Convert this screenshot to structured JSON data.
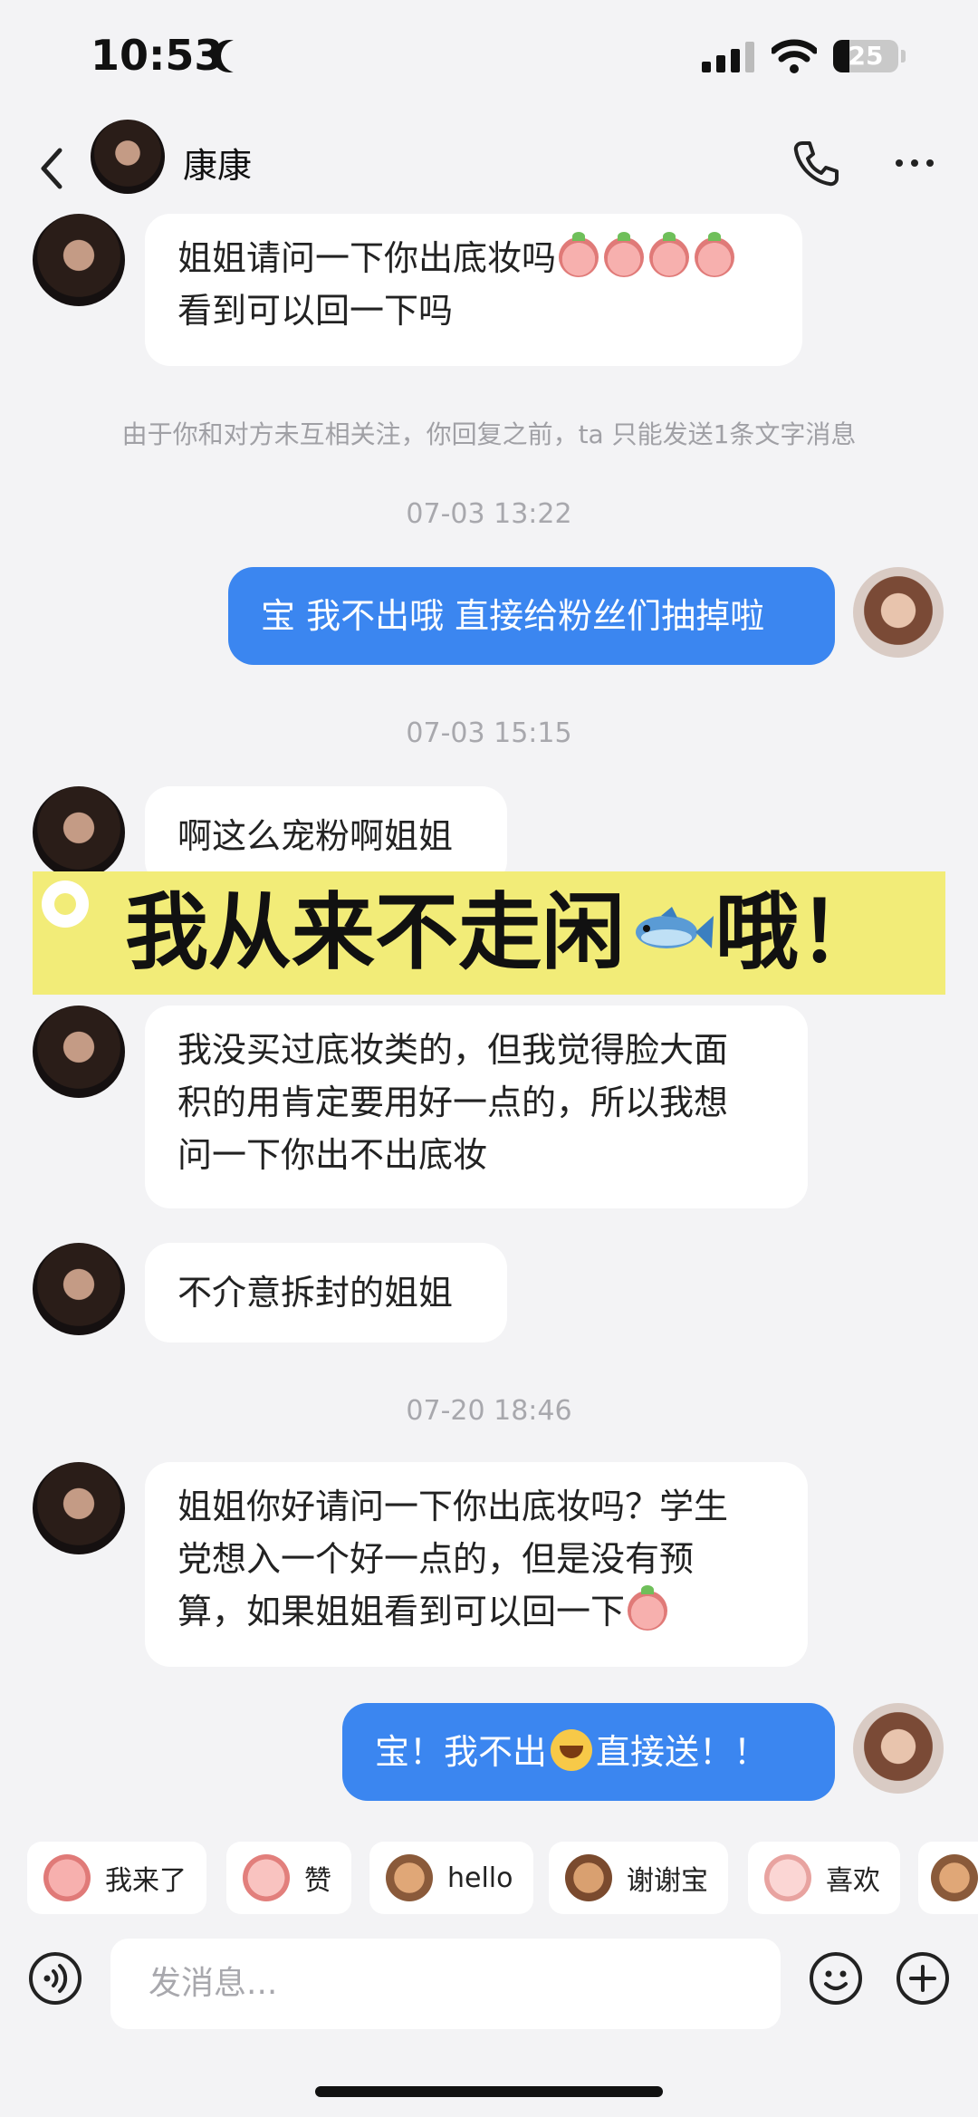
{
  "status_bar": {
    "time": "10:53",
    "battery": "25",
    "battery_level": 0.25
  },
  "header": {
    "contact_name": "康康"
  },
  "messages": {
    "m1_line1": "姐姐请问一下你出底妆吗",
    "m1_line2": "看到可以回一下吗",
    "system_notice": "由于你和对方未互相关注，你回复之前，ta 只能发送1条文字消息",
    "ts1": "07-03 13:22",
    "m2": "宝 我不出哦 直接给粉丝们抽掉啦",
    "ts2": "07-03 15:15",
    "m3": "啊这么宠粉啊姐姐",
    "m4_line1": "我没买过底妆类的，但我觉得脸大面",
    "m4_line2": "积的用肯定要用好一点的，所以我想",
    "m4_line3": "问一下你出不出底妆",
    "m5": "不介意拆封的姐姐",
    "ts3": "07-20 18:46",
    "m6_line1": "姐姐你好请问一下你出底妆吗？学生",
    "m6_line2": "党想入一个好一点的，但是没有预",
    "m6_line3": "算，如果姐姐看到可以回一下",
    "m7_part1": "宝！我不出",
    "m7_part2": "直接送！！"
  },
  "banner": {
    "text_part1": "我从来不走闲",
    "text_part2": "哦！",
    "color": "#f2ec78"
  },
  "stickers": [
    {
      "label": "我来了",
      "icon": "sticker-wolaile-icon"
    },
    {
      "label": "赞",
      "icon": "sticker-zan-icon"
    },
    {
      "label": "hello",
      "icon": "sticker-hello-icon"
    },
    {
      "label": "谢谢宝",
      "icon": "sticker-xiexiebao-icon"
    },
    {
      "label": "喜欢",
      "icon": "sticker-xihuan-icon"
    }
  ],
  "input": {
    "placeholder": "发消息..."
  },
  "colors": {
    "outgoing_bubble": "#3b86f0",
    "incoming_bubble": "#ffffff",
    "background": "#f3f3f5"
  }
}
